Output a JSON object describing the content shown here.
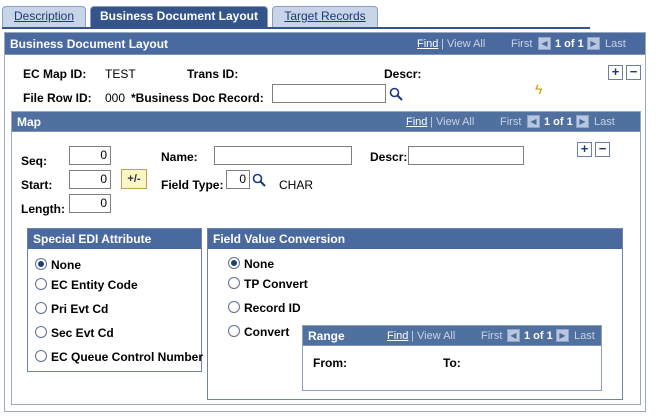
{
  "tabs": [
    {
      "label": "Description"
    },
    {
      "label": "Business Document Layout"
    },
    {
      "label": "Target Records"
    }
  ],
  "main_panel": {
    "title": "Business Document Layout",
    "nav": {
      "find": "Find",
      "view_all": "View All",
      "first": "First",
      "count": "1 of 1",
      "last": "Last"
    }
  },
  "header_fields": {
    "ec_map_id_label": "EC Map ID:",
    "ec_map_id_value": "TEST",
    "trans_id_label": "Trans ID:",
    "descr_label": "Descr:",
    "file_row_id_label": "File Row ID:",
    "file_row_id_value": "000",
    "business_doc_record_label": "*Business Doc Record:",
    "business_doc_record_value": ""
  },
  "map_panel": {
    "title": "Map",
    "nav": {
      "find": "Find",
      "view_all": "View All",
      "first": "First",
      "count": "1 of 1",
      "last": "Last"
    },
    "seq_label": "Seq:",
    "seq_value": "0",
    "start_label": "Start:",
    "start_value": "0",
    "length_label": "Length:",
    "length_value": "0",
    "plusminus_label": "+/-",
    "name_label": "Name:",
    "name_value": "",
    "descr_label": "Descr:",
    "descr_value": "",
    "field_type_label": "Field Type:",
    "field_type_value": "0",
    "field_type_desc": "CHAR"
  },
  "special_edi": {
    "title": "Special EDI Attribute",
    "options": [
      "None",
      "EC Entity Code",
      "Pri Evt Cd",
      "Sec Evt Cd",
      "EC Queue Control Number"
    ],
    "selected": "None"
  },
  "field_value_conversion": {
    "title": "Field Value Conversion",
    "options": [
      "None",
      "TP Convert",
      "Record ID",
      "Convert"
    ],
    "selected": "None"
  },
  "range_panel": {
    "title": "Range",
    "nav": {
      "find": "Find",
      "view_all": "View All",
      "first": "First",
      "count": "1 of 1",
      "last": "Last"
    },
    "from_label": "From:",
    "to_label": "To:"
  },
  "colors": {
    "header_blue": "#4a6a9f",
    "tab_active": "#35548a",
    "tab_inactive": "#c8d4e8"
  }
}
